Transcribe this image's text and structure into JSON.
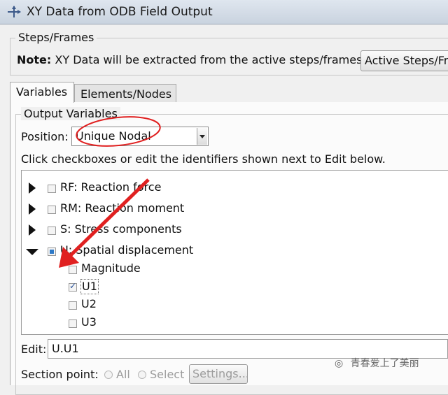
{
  "window": {
    "title": "XY Data from ODB Field Output"
  },
  "steps_frames": {
    "group_label": "Steps/Frames",
    "note_label": "Note:",
    "note_text": "XY Data will be extracted from the active steps/frames",
    "active_button_label": "Active Steps/Fra"
  },
  "tabs": [
    {
      "label": "Variables",
      "active": true
    },
    {
      "label": "Elements/Nodes",
      "active": false
    }
  ],
  "output_variables": {
    "group_label": "Output Variables",
    "position_label": "Position:",
    "position_value": "Unique Nodal",
    "instructions": "Click checkboxes or edit the identifiers shown next to Edit below."
  },
  "tree": {
    "items": [
      {
        "label": "RF: Reaction force",
        "expanded": false,
        "state": "unchecked"
      },
      {
        "label": "RM: Reaction moment",
        "expanded": false,
        "state": "unchecked"
      },
      {
        "label": "S: Stress components",
        "expanded": false,
        "state": "unchecked"
      },
      {
        "label": "U: Spatial displacement",
        "expanded": true,
        "state": "partial",
        "children": [
          {
            "label": "Magnitude",
            "checked": false
          },
          {
            "label": "U1",
            "checked": true
          },
          {
            "label": "U2",
            "checked": false
          },
          {
            "label": "U3",
            "checked": false
          }
        ]
      }
    ]
  },
  "edit": {
    "label": "Edit:",
    "value": "U.U1"
  },
  "section_point": {
    "label": "Section point:",
    "option_all": "All",
    "option_select": "Select",
    "settings_button": "Settings..."
  },
  "watermark": "青春爱上了美丽",
  "colors": {
    "annotation_red": "#e02020",
    "partial_check_fill": "#2d79c7"
  }
}
